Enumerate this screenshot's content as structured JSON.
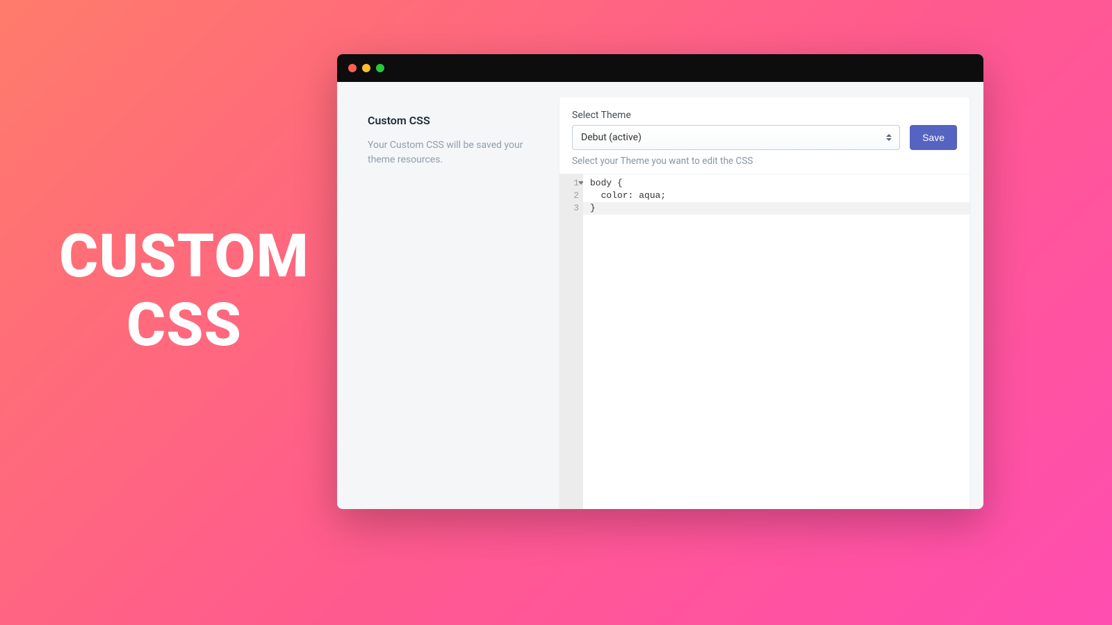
{
  "hero": {
    "line1": "CUSTOM",
    "line2": "CSS"
  },
  "sidebar": {
    "title": "Custom CSS",
    "desc": "Your Custom CSS will be saved your theme resources."
  },
  "panel": {
    "select_label": "Select Theme",
    "select_value": "Debut (active)",
    "save_label": "Save",
    "helper": "Select your Theme you want to edit the CSS"
  },
  "editor": {
    "lines": [
      {
        "n": "1",
        "text": "body {",
        "fold": true,
        "active": false
      },
      {
        "n": "2",
        "text": "  color: aqua;",
        "fold": false,
        "active": false
      },
      {
        "n": "3",
        "text": "}",
        "fold": false,
        "active": true
      }
    ]
  }
}
